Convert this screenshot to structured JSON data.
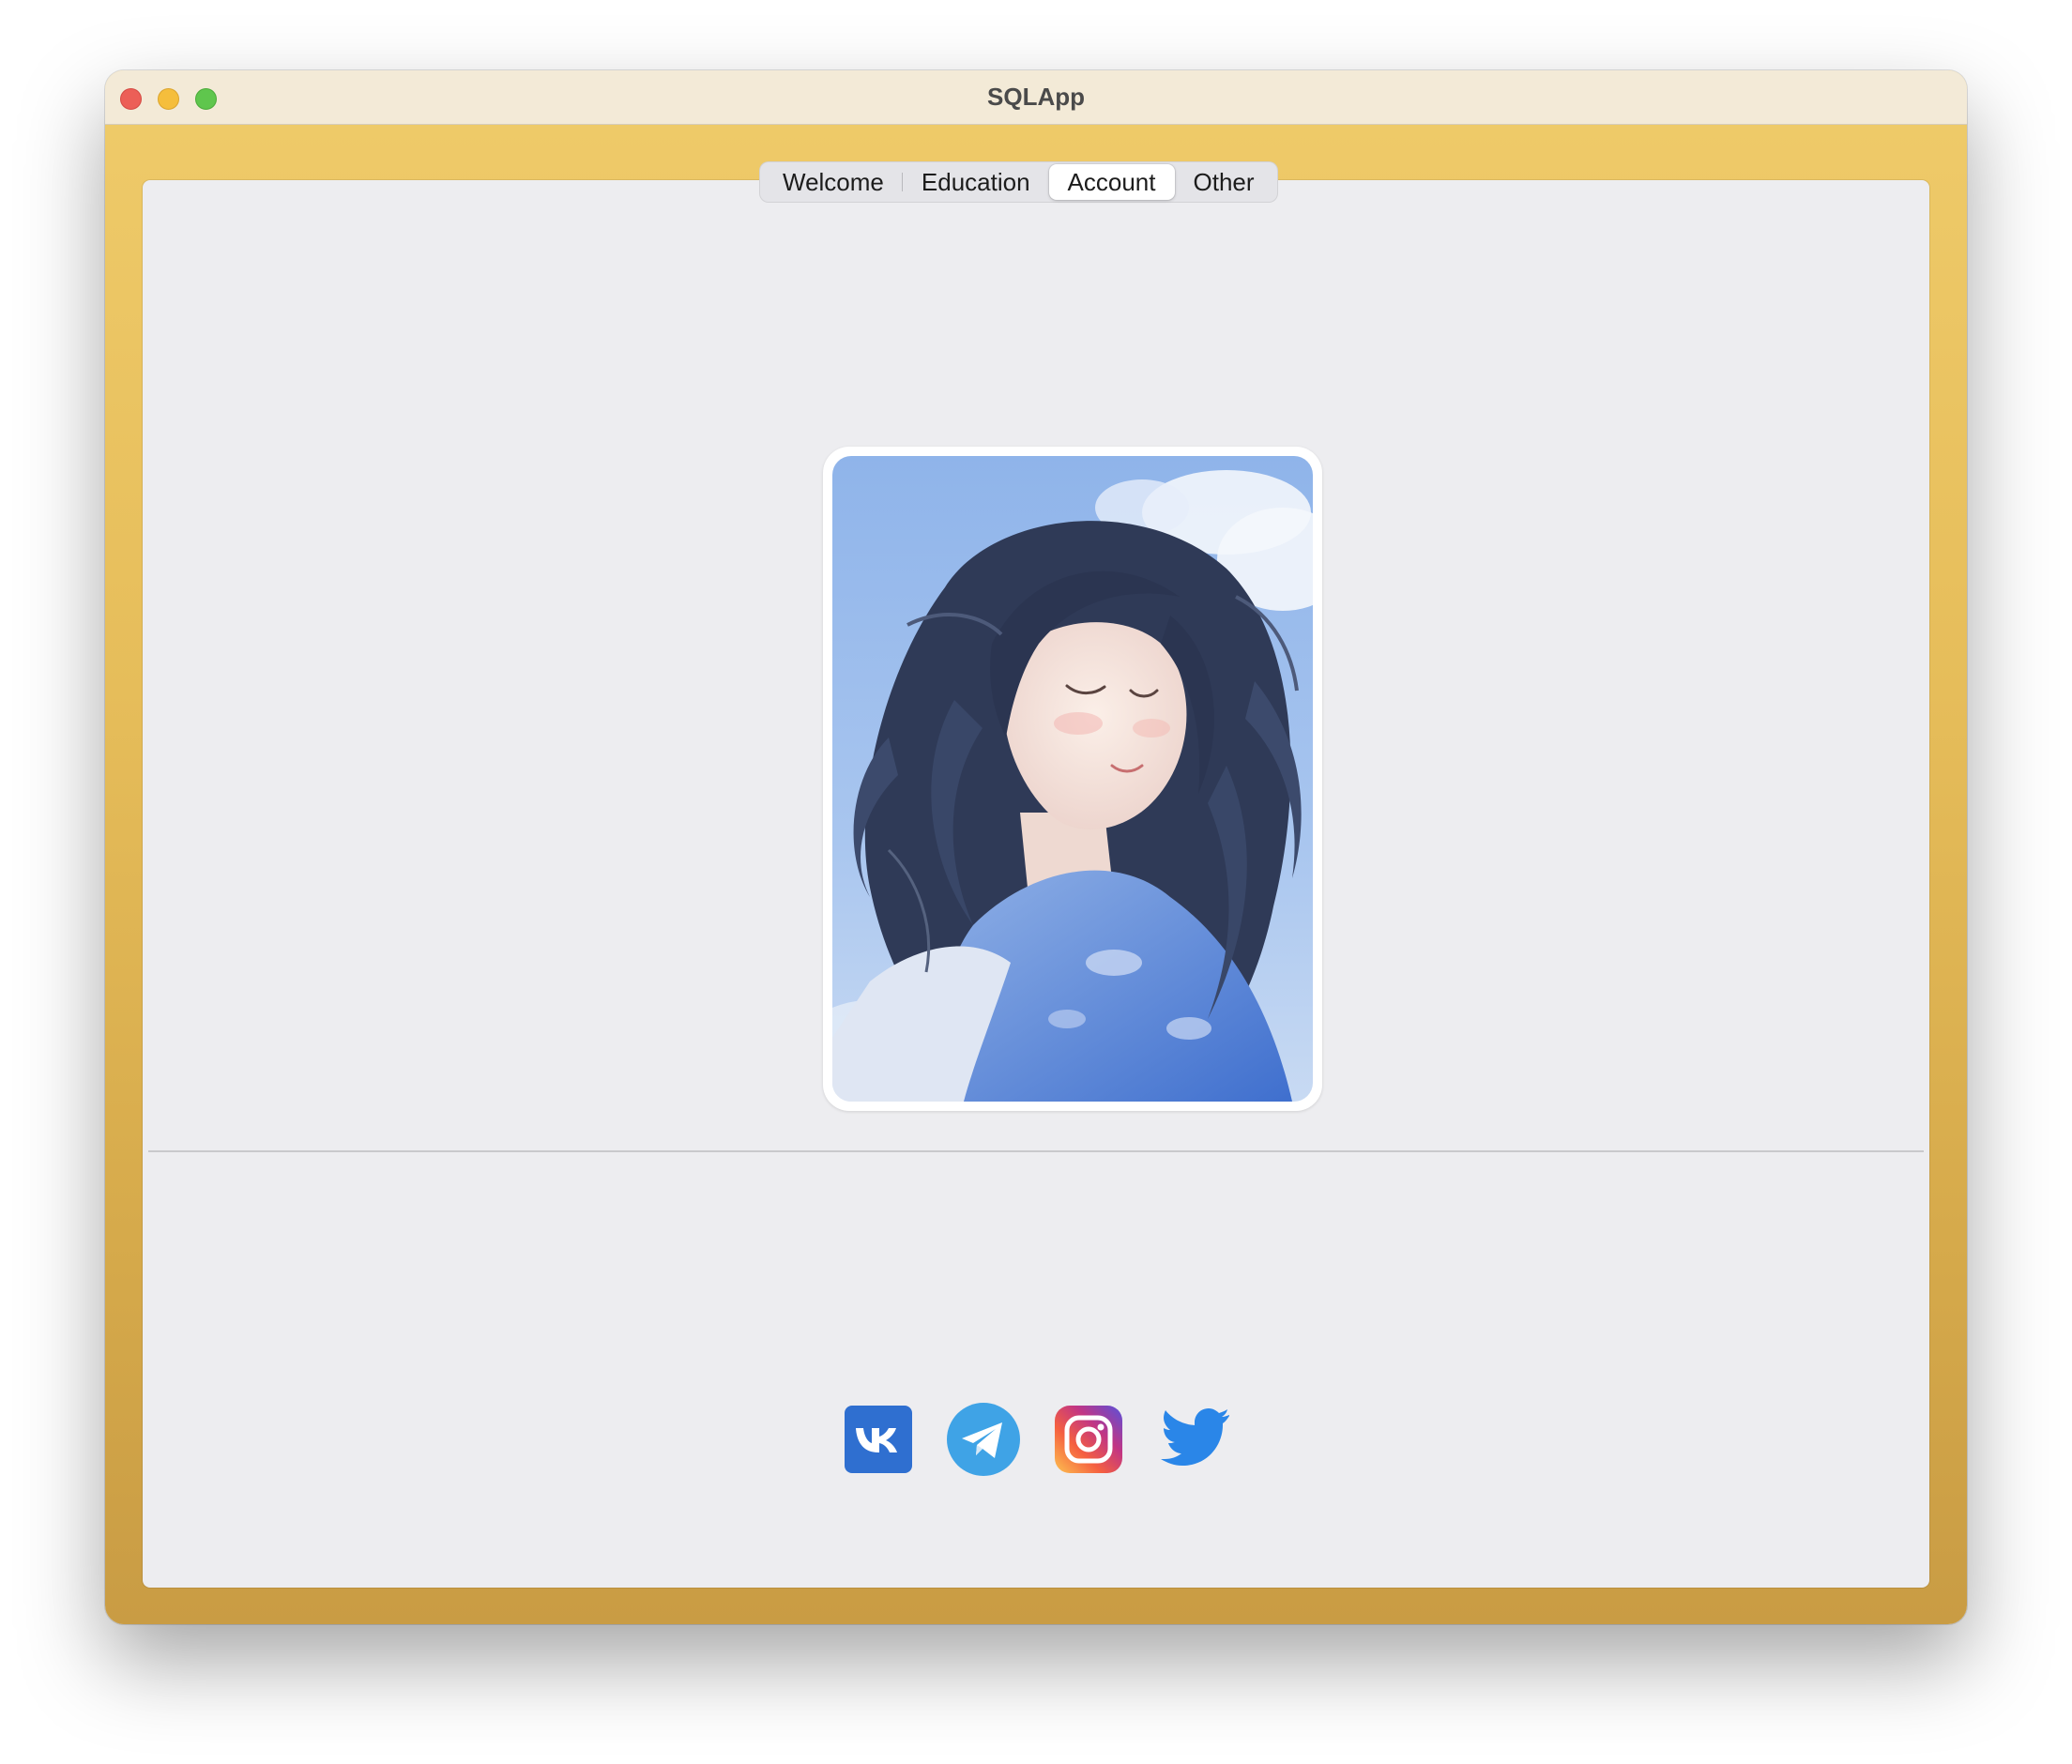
{
  "window": {
    "title": "SQLApp"
  },
  "tabs": [
    {
      "label": "Welcome",
      "active": false
    },
    {
      "label": "Education",
      "active": false
    },
    {
      "label": "Account",
      "active": true
    },
    {
      "label": "Other",
      "active": false
    }
  ],
  "profile": {
    "photo_icon": "profile-photo"
  },
  "social": [
    {
      "name": "vk",
      "icon": "vk-icon",
      "color": "#2f6fd0"
    },
    {
      "name": "telegram",
      "icon": "telegram-icon",
      "color": "#3fa3e6"
    },
    {
      "name": "instagram",
      "icon": "instagram-icon",
      "color": "#c13584"
    },
    {
      "name": "twitter",
      "icon": "twitter-icon",
      "color": "#2a86e8"
    }
  ],
  "colors": {
    "window_frame": "#e6bd5a",
    "titlebar": "#f3ead7",
    "content_bg": "#ededf0"
  }
}
